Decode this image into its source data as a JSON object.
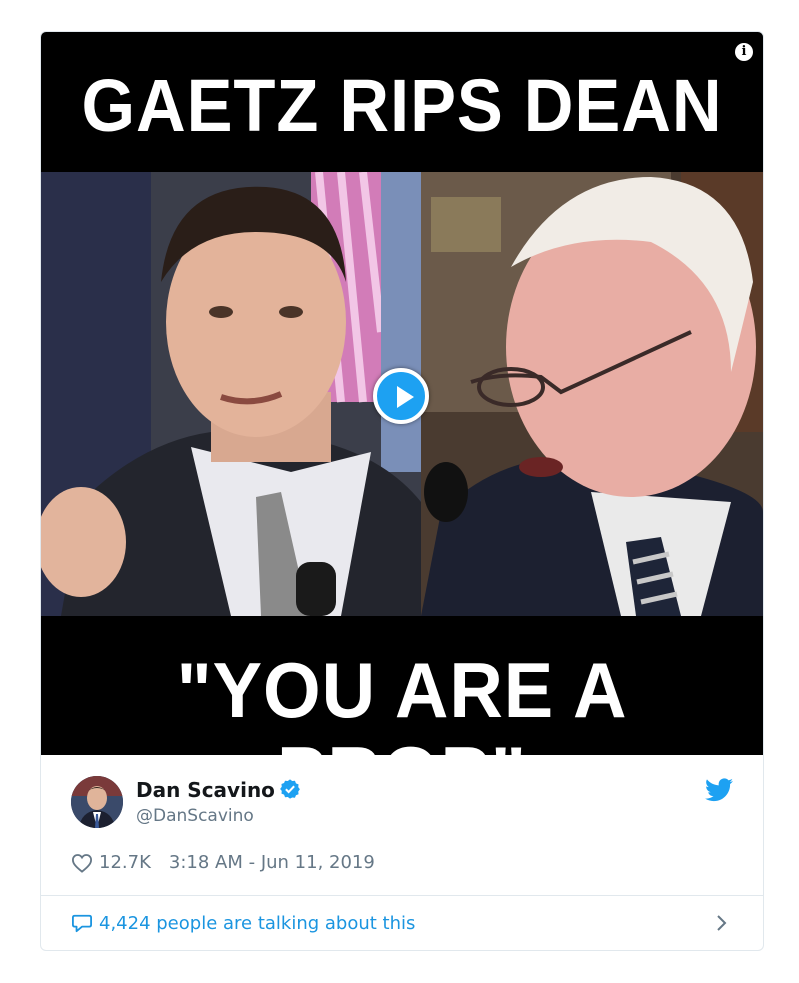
{
  "media": {
    "headline_top": "GAETZ RIPS DEAN",
    "headline_bottom": "\"YOU ARE A PROP\"",
    "info_icon": "info-icon",
    "play_icon": "play-icon"
  },
  "author": {
    "name": "Dan Scavino",
    "handle": "@DanScavino",
    "verified_icon": "verified-badge-icon",
    "avatar": "avatar"
  },
  "tweet": {
    "likes": "12.7K",
    "time": "3:18 AM - Jun 11, 2019",
    "talking": "4,424 people are talking about this"
  },
  "colors": {
    "twitter_blue": "#1da1f2",
    "link_blue": "#1b95e0",
    "muted": "#657786",
    "text": "#14171a"
  }
}
